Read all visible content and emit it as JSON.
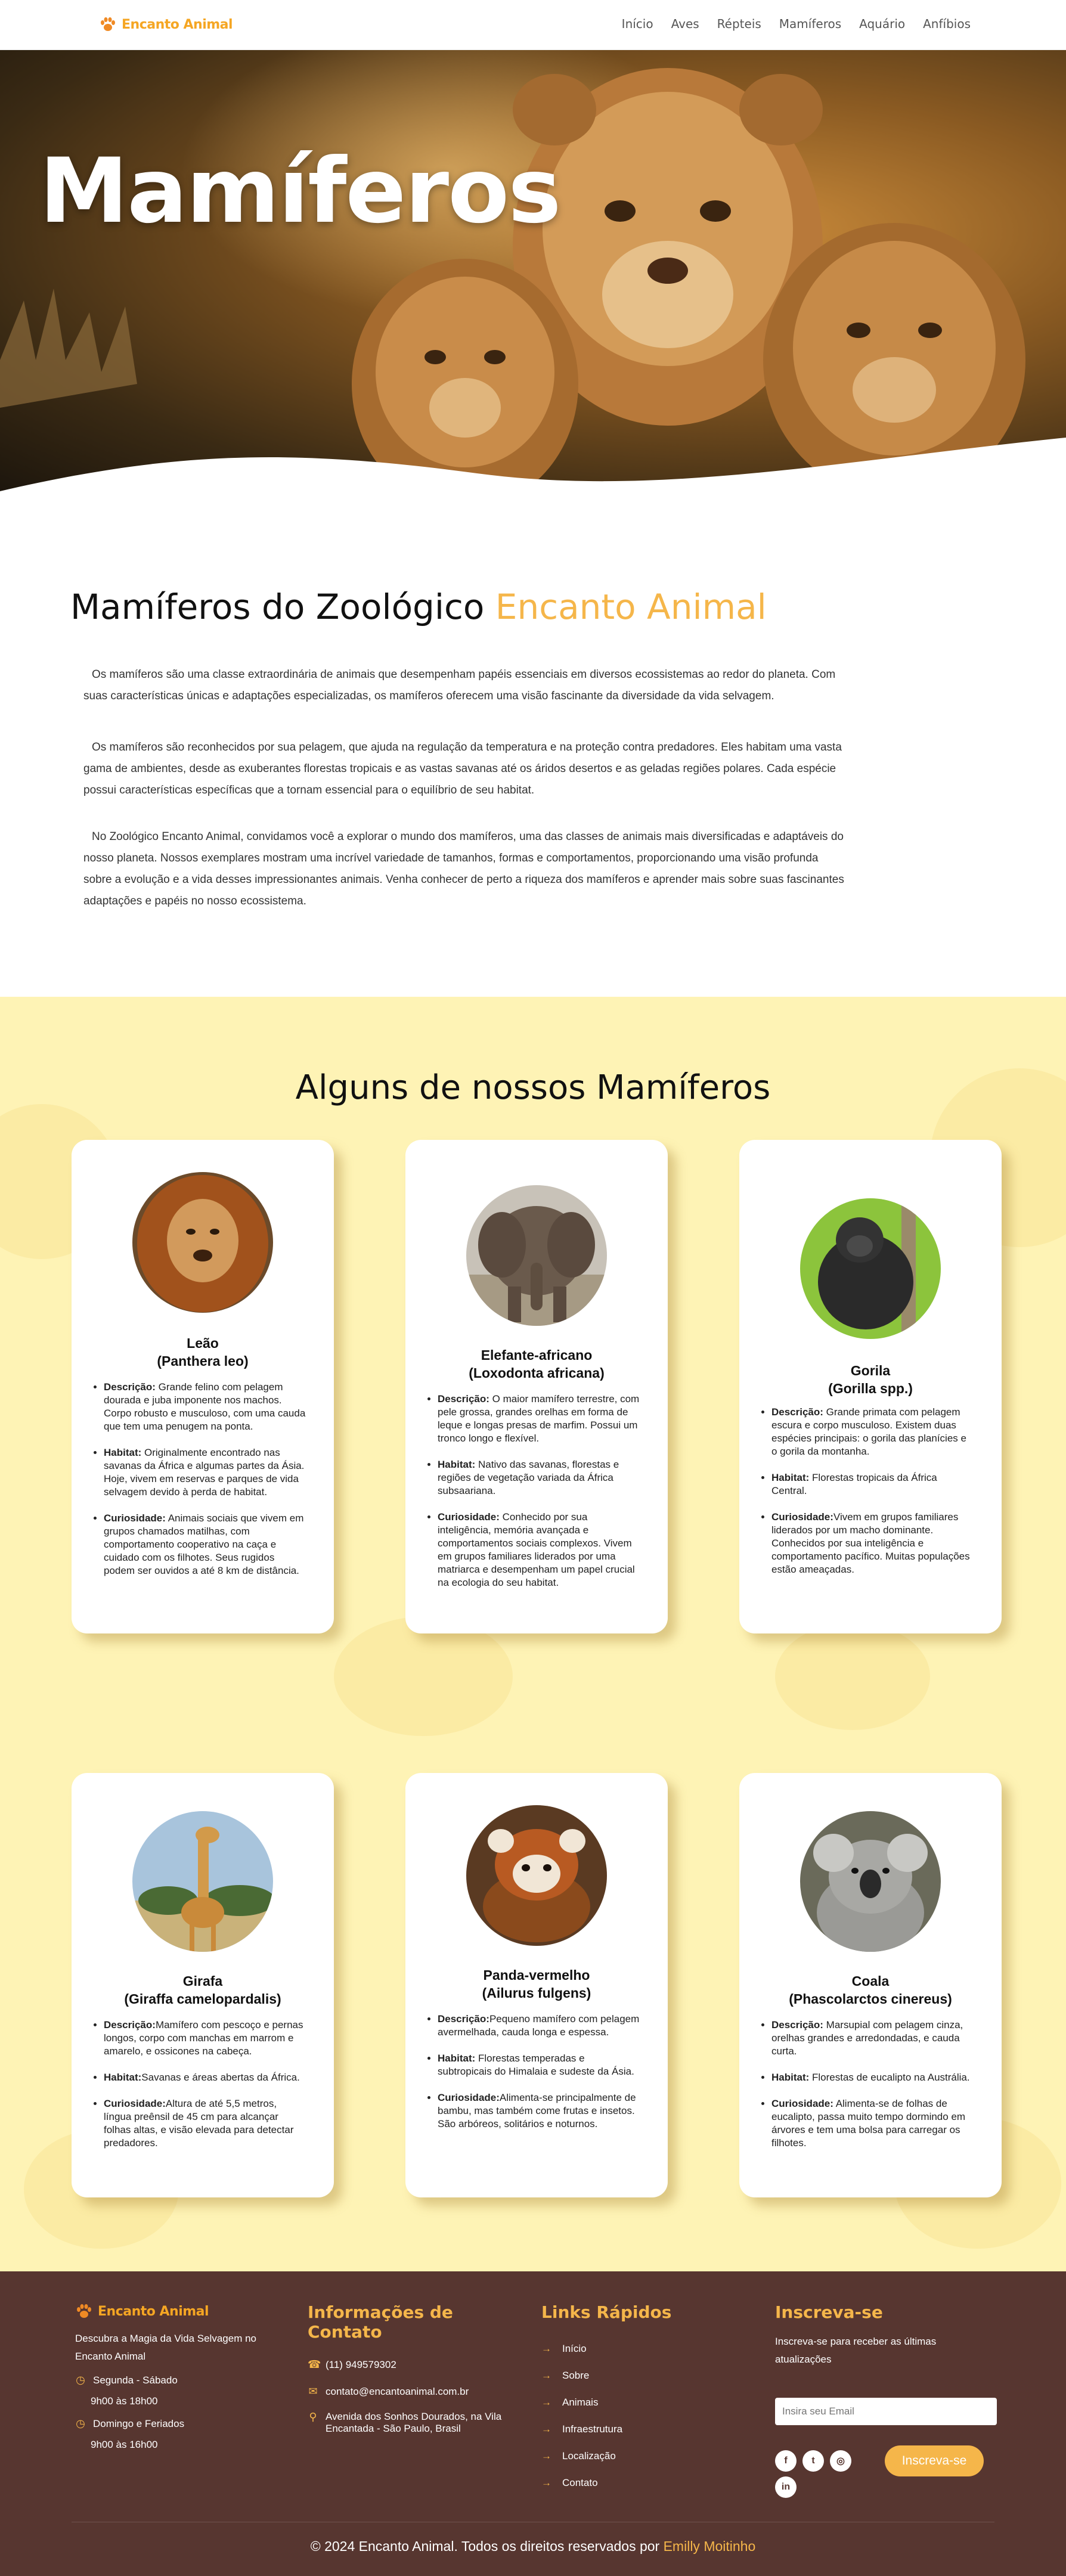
{
  "nav": {
    "logo_text": "Encanto Animal",
    "links": [
      "Início",
      "Aves",
      "Répteis",
      "Mamíferos",
      "Aquário",
      "Anfíbios"
    ]
  },
  "hero": {
    "title": "Mamíferos"
  },
  "intro": {
    "heading_main": "Mamíferos do Zoológico ",
    "heading_accent": "Encanto Animal",
    "paragraphs": [
      "Os mamíferos são uma classe extraordinária de animais que desempenham papéis essenciais em diversos ecossistemas ao redor do planeta. Com suas características únicas e adaptações especializadas, os mamíferos oferecem uma visão fascinante da diversidade da vida selvagem.",
      "Os mamíferos são reconhecidos por sua pelagem, que ajuda na regulação da temperatura e na proteção contra predadores. Eles habitam uma vasta gama de ambientes, desde as exuberantes florestas tropicais e as vastas savanas até os áridos desertos e as geladas regiões polares. Cada espécie possui características específicas que a tornam essencial para o equilíbrio de seu habitat.",
      "No Zoológico Encanto Animal, convidamos você a explorar o mundo dos mamíferos, uma das classes de animais mais diversificadas e adaptáveis do nosso planeta. Nossos exemplares mostram uma incrível variedade de tamanhos, formas e comportamentos, proporcionando uma visão profunda sobre a evolução e a vida desses impressionantes animais. Venha conhecer de perto a riqueza dos mamíferos e aprender mais sobre suas fascinantes adaptações e papéis no nosso ecossistema."
    ]
  },
  "animals": {
    "heading": "Alguns de nossos Mamíferos",
    "cards": [
      {
        "name": "Leão",
        "scientific": "(Panthera leo)",
        "items": [
          {
            "label": "Descrição:",
            "text": " Grande felino com pelagem dourada e juba imponente nos machos. Corpo robusto e musculoso, com uma cauda que tem uma penugem na ponta."
          },
          {
            "label": "Habitat:",
            "text": " Originalmente encontrado nas savanas da África e algumas partes da Ásia. Hoje, vivem em reservas e parques de vida selvagem devido à perda de habitat."
          },
          {
            "label": "Curiosidade:",
            "text": " Animais sociais que vivem em grupos chamados matilhas, com comportamento cooperativo na caça e cuidado com os filhotes. Seus rugidos podem ser ouvidos a até 8 km de distância."
          }
        ]
      },
      {
        "name": "Elefante-africano",
        "scientific": "(Loxodonta africana)",
        "items": [
          {
            "label": "Descrição:",
            "text": " O maior mamífero terrestre, com pele grossa, grandes orelhas em forma de leque e longas presas de marfim. Possui um tronco longo e flexível."
          },
          {
            "label": "Habitat:",
            "text": " Nativo das savanas, florestas e regiões de vegetação variada da África subsaariana."
          },
          {
            "label": "Curiosidade:",
            "text": " Conhecido por sua inteligência, memória avançada e comportamentos sociais complexos. Vivem em grupos familiares liderados por uma matriarca e desempenham um papel crucial na ecologia do seu habitat."
          }
        ]
      },
      {
        "name": "Gorila",
        "scientific": "(Gorilla spp.)",
        "items": [
          {
            "label": "Descrição:",
            "text": " Grande primata com pelagem escura e corpo musculoso. Existem duas espécies principais: o gorila das planícies e o gorila da montanha."
          },
          {
            "label": "Habitat:",
            "text": " Florestas tropicais da África Central."
          },
          {
            "label": "Curiosidade:",
            "text": "Vivem em grupos familiares liderados por um macho dominante. Conhecidos por sua inteligência e comportamento pacífico. Muitas populações estão ameaçadas."
          }
        ]
      },
      {
        "name": "Girafa",
        "scientific": "(Giraffa camelopardalis)",
        "items": [
          {
            "label": "Descrição:",
            "text": "Mamífero com pescoço e pernas longos, corpo com manchas em marrom e amarelo, e ossicones na cabeça."
          },
          {
            "label": "Habitat:",
            "text": "Savanas e áreas abertas da África."
          },
          {
            "label": "Curiosidade:",
            "text": "Altura de até 5,5 metros, língua preênsil de 45 cm para alcançar folhas altas, e visão elevada para detectar predadores."
          }
        ]
      },
      {
        "name": "Panda-vermelho",
        "scientific": "(Ailurus fulgens)",
        "items": [
          {
            "label": "Descrição:",
            "text": "Pequeno mamífero com pelagem avermelhada, cauda longa e espessa."
          },
          {
            "label": "Habitat:",
            "text": " Florestas temperadas e subtropicais do Himalaia e sudeste da Ásia."
          },
          {
            "label": "Curiosidade:",
            "text": "Alimenta-se principalmente de bambu, mas também come frutas e insetos. São arbóreos, solitários e noturnos."
          }
        ]
      },
      {
        "name": "Coala",
        "scientific": "(Phascolarctos cinereus)",
        "items": [
          {
            "label": "Descrição:",
            "text": " Marsupial com pelagem cinza, orelhas grandes e arredondadas, e cauda curta."
          },
          {
            "label": "Habitat:",
            "text": " Florestas de eucalipto na Austrália."
          },
          {
            "label": "Curiosidade:",
            "text": " Alimenta-se de folhas de eucalipto, passa muito tempo dormindo em árvores e tem uma bolsa para carregar os filhotes."
          }
        ]
      }
    ]
  },
  "footer": {
    "logo_text": "Encanto Animal",
    "tagline": "Descubra a Magia da Vida Selvagem no Encanto Animal",
    "hours": [
      {
        "days": "Segunda - Sábado",
        "time": "9h00 às 18h00"
      },
      {
        "days": "Domingo e Feriados",
        "time": "9h00 às 16h00"
      }
    ],
    "contact_heading": "Informações de Contato",
    "phone": "(11) 949579302",
    "email": "contato@encantoanimal.com.br",
    "address": "Avenida dos Sonhos Dourados, na Vila Encantada - São Paulo, Brasil",
    "links_heading": "Links Rápidos",
    "links": [
      "Início",
      "Sobre",
      "Animais",
      "Infraestrutura",
      "Localização",
      "Contato"
    ],
    "subscribe_heading": "Inscreva-se",
    "subscribe_text": "Inscreva-se para receber as últimas atualizações",
    "email_placeholder": "Insira seu Email",
    "subscribe_button": "Inscreva-se",
    "copyright_main": "© 2024 Encanto Animal. Todos os direitos reservados por ",
    "copyright_accent": "Emilly Moitinho"
  }
}
